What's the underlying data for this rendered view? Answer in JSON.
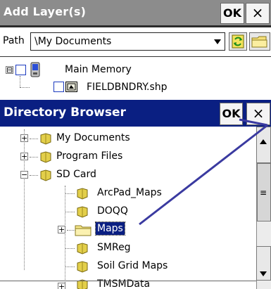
{
  "main_window": {
    "title": "Add Layer(s)",
    "ok_label": "OK",
    "close_label": "×",
    "path_label": "Path",
    "path_value": "\\My Documents",
    "tree": [
      {
        "label": "Main Memory",
        "expander": "⊟",
        "checked": false
      },
      {
        "label": "FIELDBNDRY.shp",
        "checked": false
      }
    ]
  },
  "dialog": {
    "title": "Directory Browser",
    "ok_label": "OK",
    "close_label": "×",
    "items": [
      {
        "label": "My Documents",
        "expander": "+",
        "level": 0
      },
      {
        "label": "Program Files",
        "expander": "+",
        "level": 0
      },
      {
        "label": "SD Card",
        "expander": "−",
        "level": 0
      },
      {
        "label": "ArcPad_Maps",
        "expander": "",
        "level": 1
      },
      {
        "label": "DOQQ",
        "expander": "",
        "level": 1
      },
      {
        "label": "Maps",
        "expander": "+",
        "level": 1,
        "selected": true
      },
      {
        "label": "SMReg",
        "expander": "",
        "level": 1
      },
      {
        "label": "Soil Grid Maps",
        "expander": "",
        "level": 1
      },
      {
        "label": "TMSMData",
        "expander": "+",
        "level": 1
      }
    ]
  },
  "colors": {
    "title_gray": "#8c8c8c",
    "dialog_blue": "#0a1f82",
    "annotation": "#3a3aa0"
  }
}
